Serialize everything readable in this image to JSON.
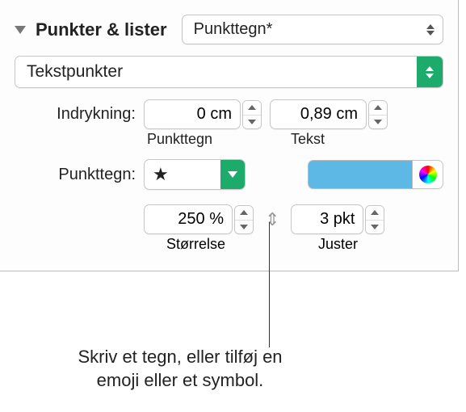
{
  "header": {
    "title": "Punkter & lister",
    "list_style_label": "Punkttegn*"
  },
  "bullet_type_label": "Tekstpunkter",
  "indent": {
    "label": "Indrykning:",
    "bullet_value": "0 cm",
    "bullet_caption": "Punkttegn",
    "text_value": "0,89 cm",
    "text_caption": "Tekst"
  },
  "bullet": {
    "label": "Punkttegn:",
    "glyph": "★",
    "color": "#5db8e6"
  },
  "size": {
    "value": "250 %",
    "caption": "Størrelse"
  },
  "align": {
    "value": "3 pkt",
    "caption": "Juster"
  },
  "callout": "Skriv et tegn, eller tilføj en emoji eller et symbol."
}
